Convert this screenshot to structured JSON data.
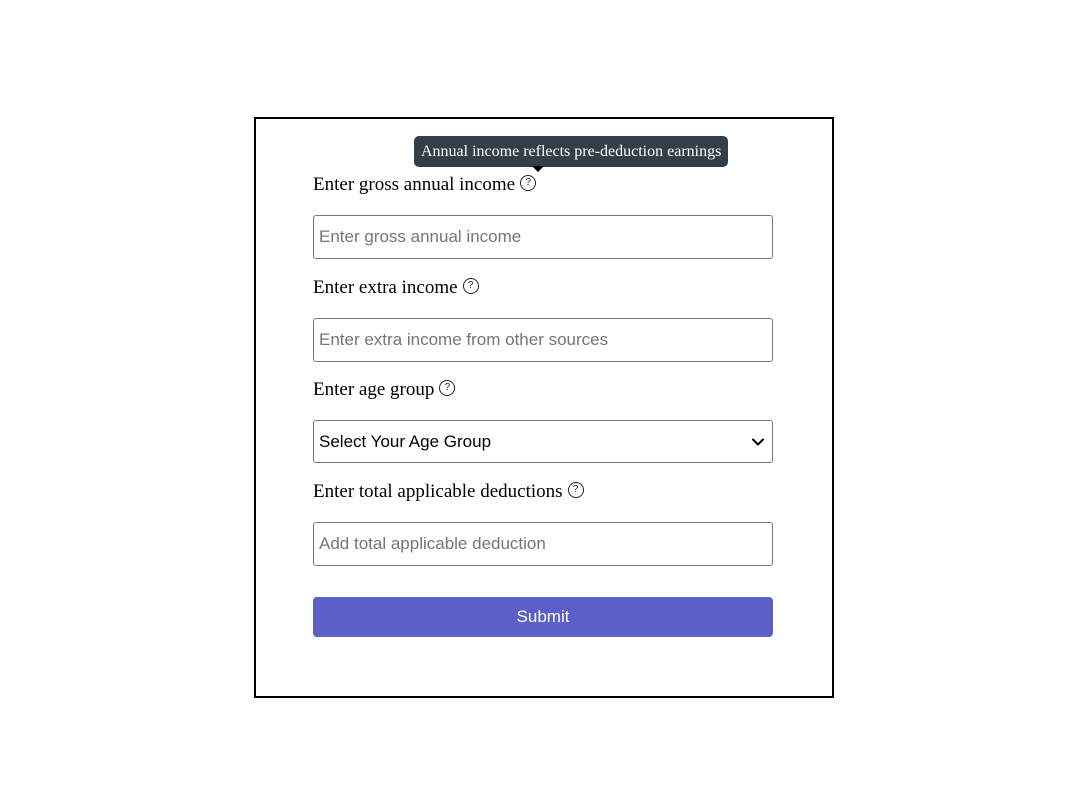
{
  "tooltip": {
    "text": "Annual income reflects pre-deduction earnings"
  },
  "form": {
    "gross_income": {
      "label": "Enter gross annual income",
      "placeholder": "Enter gross annual income",
      "value": "",
      "help_icon": "question-circle-icon"
    },
    "extra_income": {
      "label": "Enter extra income",
      "placeholder": "Enter extra income from other sources",
      "value": "",
      "help_icon": "question-circle-icon"
    },
    "age_group": {
      "label": "Enter age group",
      "selected": "Select Your Age Group",
      "help_icon": "question-circle-icon"
    },
    "deductions": {
      "label": "Enter total applicable deductions",
      "placeholder": "Add total applicable deduction",
      "value": "",
      "help_icon": "question-circle-icon"
    },
    "help_glyph": "?",
    "submit_label": "Submit"
  },
  "colors": {
    "submit_background": "#5b5fc7",
    "tooltip_background": "#333f48",
    "border": "#767676"
  }
}
